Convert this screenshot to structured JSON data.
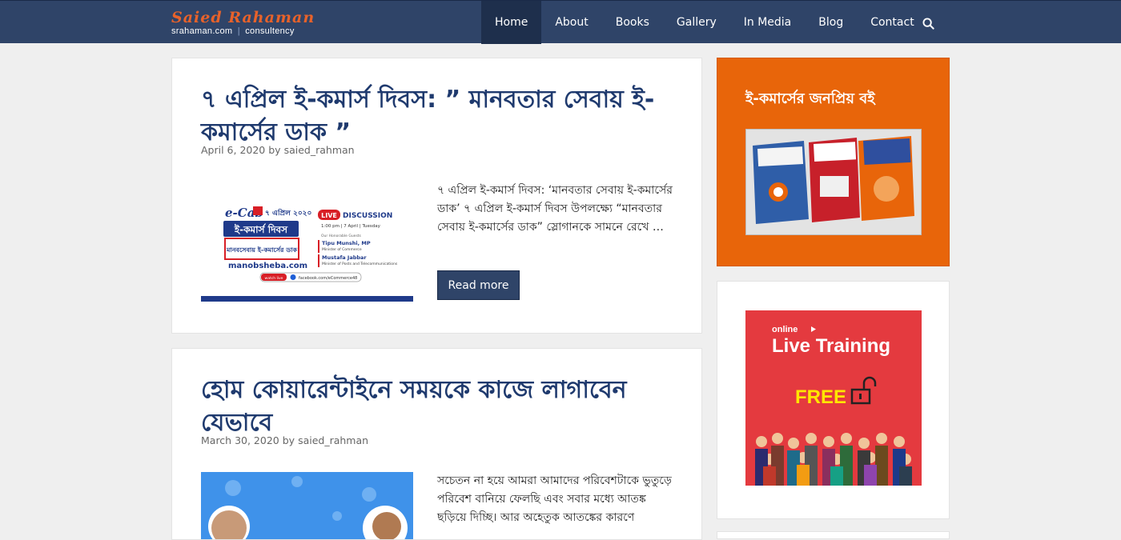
{
  "header": {
    "logo_name": "Saied Rahaman",
    "logo_site": "srahaman.com",
    "logo_tagline": "consultency",
    "nav": [
      {
        "label": "Home",
        "active": true
      },
      {
        "label": "About",
        "active": false
      },
      {
        "label": "Books",
        "active": false
      },
      {
        "label": "Gallery",
        "active": false
      },
      {
        "label": "In Media",
        "active": false
      },
      {
        "label": "Blog",
        "active": false
      },
      {
        "label": "Contact",
        "active": false
      }
    ],
    "search_icon": "search-icon"
  },
  "posts": [
    {
      "title": "৭ এপ্রিল ই-কমার্স দিবস: ” মানবতার সেবায় ই-কমার্সের ডাক ”",
      "date": "April 6, 2020",
      "by": "by",
      "author": "saied_rahman",
      "excerpt": "৭ এপ্রিল ই-কমার্স দিবস: ‘মানবতার সেবায় ই-কমার্সের ডাক’ ৭ এপ্রিল ই-কমার্স দিবস উপলক্ষ্যে “মানবতার সেবায় ই-কমার্সের ডাক” স্লোগানকে সামনে রেখে …",
      "read_more": "Read more",
      "thumb": {
        "brand": "e-Cab",
        "date_badge": "৭ এপ্রিল ২০২০",
        "banner_title": "ই-কমার্স দিবস",
        "banner_sub": "মানবসেবায় ই-কমার্সের ডাক",
        "site": "manobsheba.com",
        "live": "LIVE",
        "discussion": "DISCUSSION",
        "schedule": "1:00 pm | 7 April | Tuesday",
        "guests_label": "Our Honorable Guests",
        "guest1_name": "Tipu Munshi, MP",
        "guest1_role": "Minister of Commerce",
        "guest2_name": "Mustafa Jabbar",
        "guest2_role": "Minister of Posts and Telecommunications",
        "watch": "watch live",
        "facebook": "facebook.com/eCommerce48"
      }
    },
    {
      "title": "হোম কোয়ারেন্টাইনে সময়কে কাজে লাগাবেন যেভাবে",
      "date": "March 30, 2020",
      "by": "by",
      "author": "saied_rahman",
      "excerpt": "সচেতন না হয়ে আমরা আমাদের পরিবেশটাকে ভুতুড়ে পরিবেশ বানিয়ে ফেলছি এবং সবার মধ্যে আতঙ্ক ছড়িয়ে দিচ্ছি। আর অহেতুক আতঙ্কের কারণে"
    }
  ],
  "sidebar": {
    "books_widget_title": "ই-কমার্সের জনপ্রিয় বই",
    "training": {
      "online": "online",
      "title": "Live Training",
      "free": "FREE"
    }
  },
  "colors": {
    "header_bg": "#2f4468",
    "accent_orange": "#e8650a",
    "title_blue": "#1f3a6e",
    "training_red": "#e43a3f"
  }
}
